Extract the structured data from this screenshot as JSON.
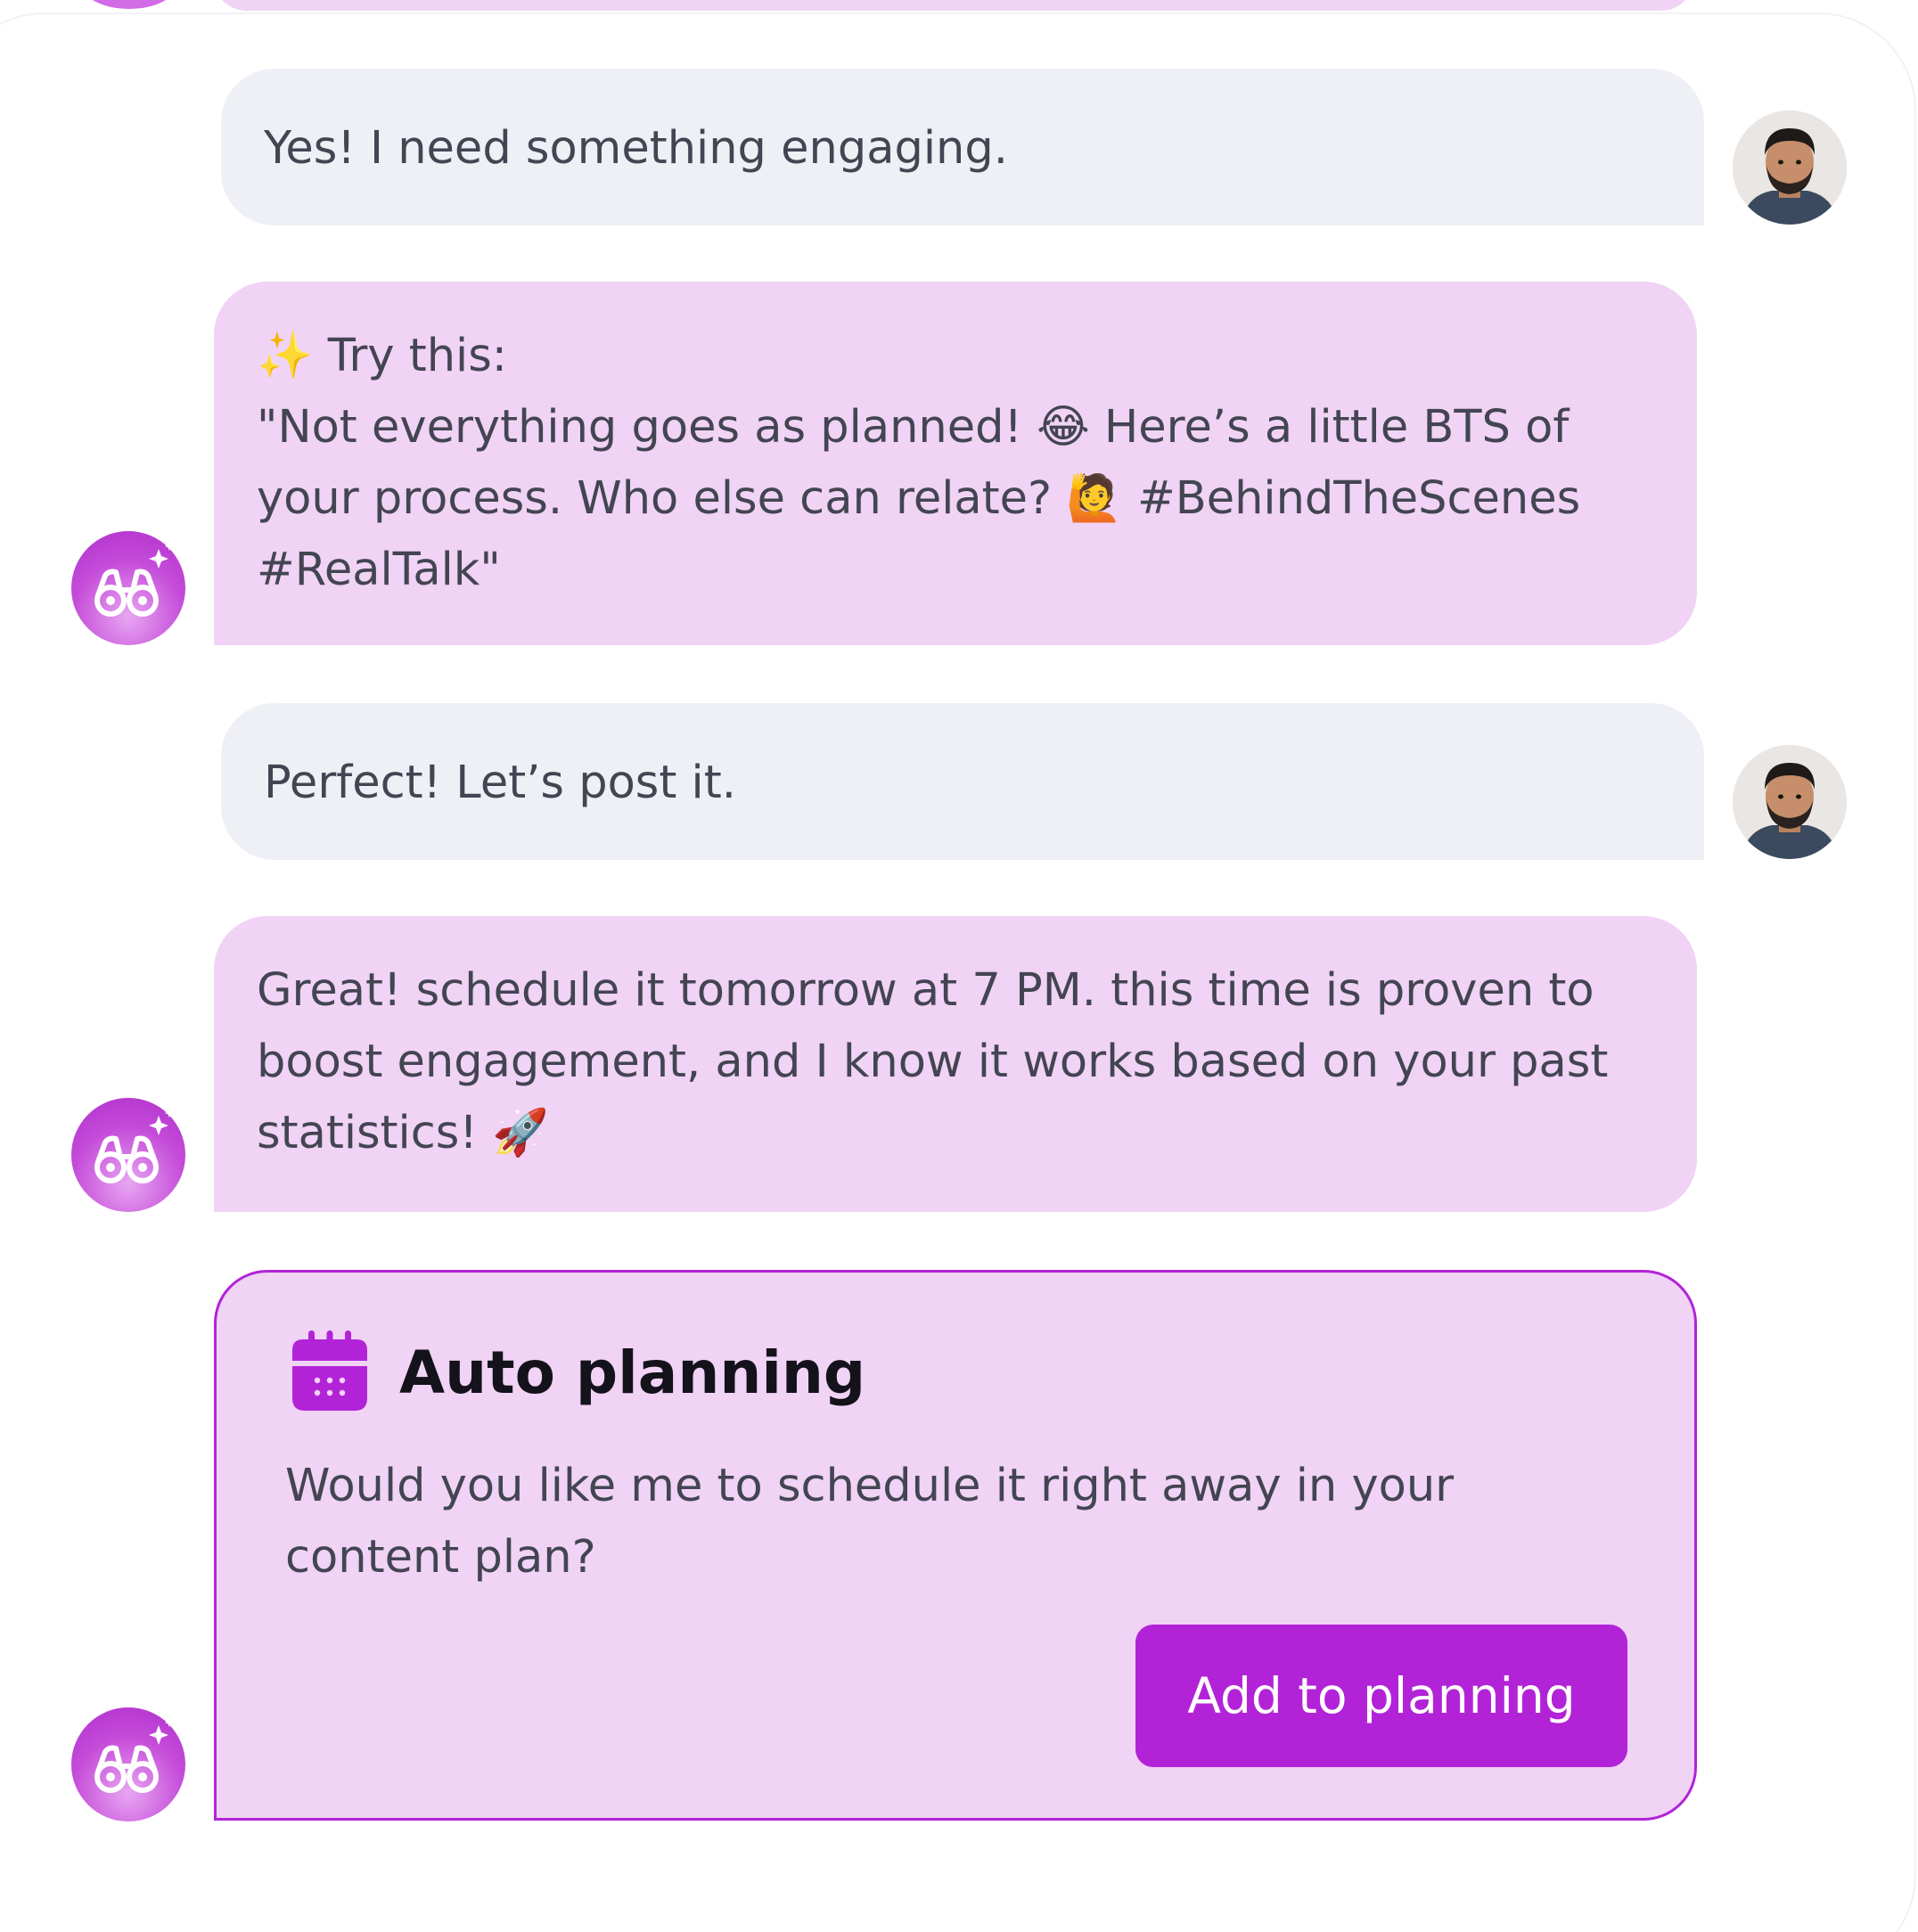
{
  "colors": {
    "assistant_bubble": "#f0d3f5",
    "user_bubble": "#eef0f6",
    "accent": "#b223d8",
    "text": "#434552",
    "title_text": "#14121a"
  },
  "messages": [
    {
      "role": "user",
      "avatar_icon": "user-photo-avatar",
      "lines": [
        "Yes! I need something engaging."
      ]
    },
    {
      "role": "assistant",
      "avatar_icon": "binoculars-sparkle-icon",
      "lines": [
        "✨ Try this:",
        "\"Not everything goes as planned! 😂 Here’s a little BTS of",
        "your process. Who else can relate? 🙋 #BehindTheScenes",
        "#RealTalk\""
      ]
    },
    {
      "role": "user",
      "avatar_icon": "user-photo-avatar",
      "lines": [
        "Perfect! Let’s post it."
      ]
    },
    {
      "role": "assistant",
      "avatar_icon": "binoculars-sparkle-icon",
      "lines": [
        "Great! schedule it tomorrow at 7 PM. this time is proven to",
        "boost engagement, and I know it works based on your past",
        "statistics! 🚀"
      ]
    }
  ],
  "auto_planning_card": {
    "icon": "calendar-icon",
    "title": "Auto planning",
    "body_lines": [
      "Would you like me to schedule it right away in your",
      "content plan?"
    ],
    "button_label": "Add to planning"
  }
}
